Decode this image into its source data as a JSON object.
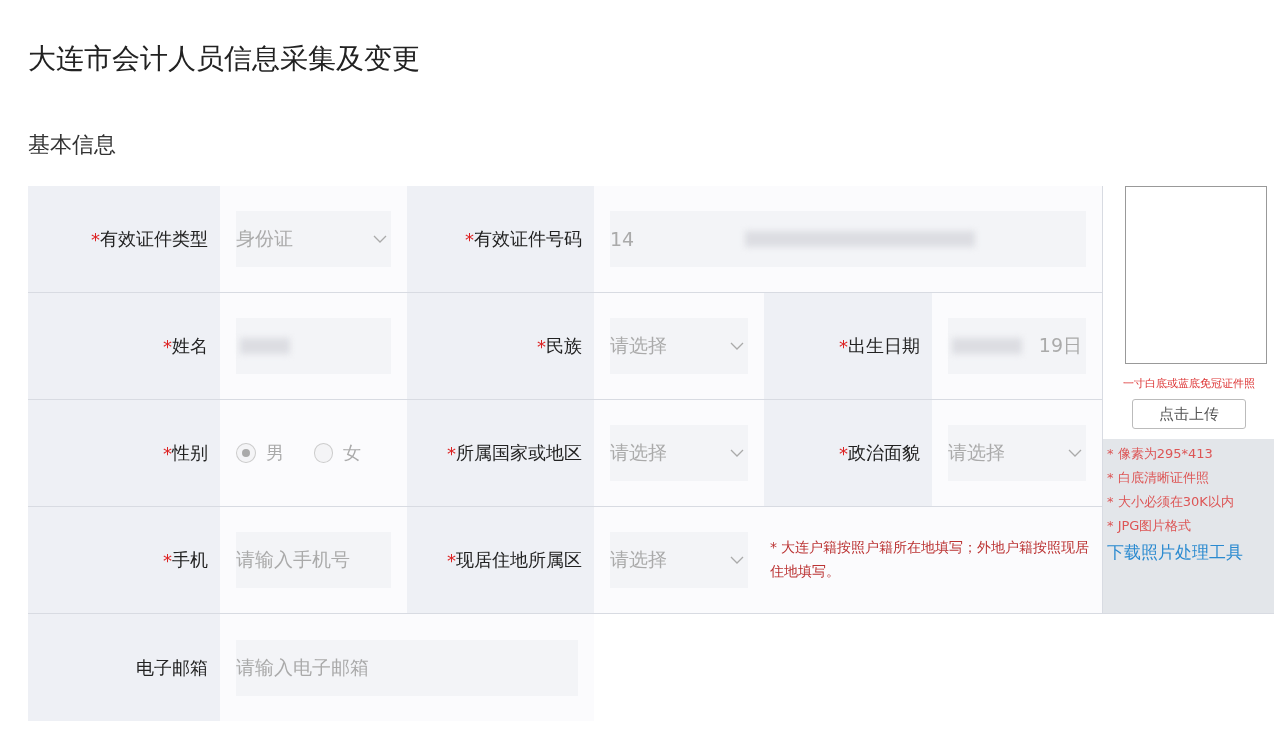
{
  "title": "大连市会计人员信息采集及变更",
  "section": "基本信息",
  "rows": [
    [
      {
        "label": "有效证件类型",
        "mark": "*",
        "kind": "select",
        "value": "身份证",
        "disabled": true
      },
      {
        "label": "有效证件号码",
        "mark": "*",
        "kind": "text",
        "value": "14",
        "blurred": true
      }
    ],
    [
      {
        "label": "姓名",
        "mark": "*",
        "kind": "text",
        "blurred": true
      },
      {
        "label": "民族",
        "mark": "*",
        "kind": "select",
        "placeholder": "请选择"
      },
      {
        "label": "出生日期",
        "mark": "*",
        "kind": "text",
        "value": "19日",
        "blurred": true
      }
    ],
    [
      {
        "label": "性别",
        "mark": "*",
        "kind": "radio",
        "options": [
          {
            "label": "男",
            "selected": true
          },
          {
            "label": "女",
            "selected": false
          }
        ]
      },
      {
        "label": "所属国家或地区",
        "mark": "*",
        "kind": "select",
        "placeholder": "请选择"
      },
      {
        "label": "政治面貌",
        "mark": "*",
        "kind": "select",
        "placeholder": "请选择"
      }
    ],
    [
      {
        "label": "手机",
        "mark": "*",
        "kind": "text",
        "placeholder": "请输入手机号"
      },
      {
        "label": "现居住地所属区",
        "mark": "*",
        "kind": "select",
        "placeholder": "请选择"
      },
      {
        "kind": "note",
        "text": "* 大连户籍按照户籍所在地填写；外地户籍按照现居住地填写。"
      }
    ],
    [
      {
        "label": "电子邮箱",
        "kind": "text",
        "placeholder": "请输入电子邮箱"
      }
    ]
  ],
  "photo": {
    "caption": "一寸白底或蓝底免冠证件照",
    "button": "点击上传",
    "tips": [
      "* 像素为295*413",
      "* 白底清晰证件照",
      "* 大小必须在30K以内",
      "* JPG图片格式"
    ],
    "link": "下载照片处理工具"
  }
}
